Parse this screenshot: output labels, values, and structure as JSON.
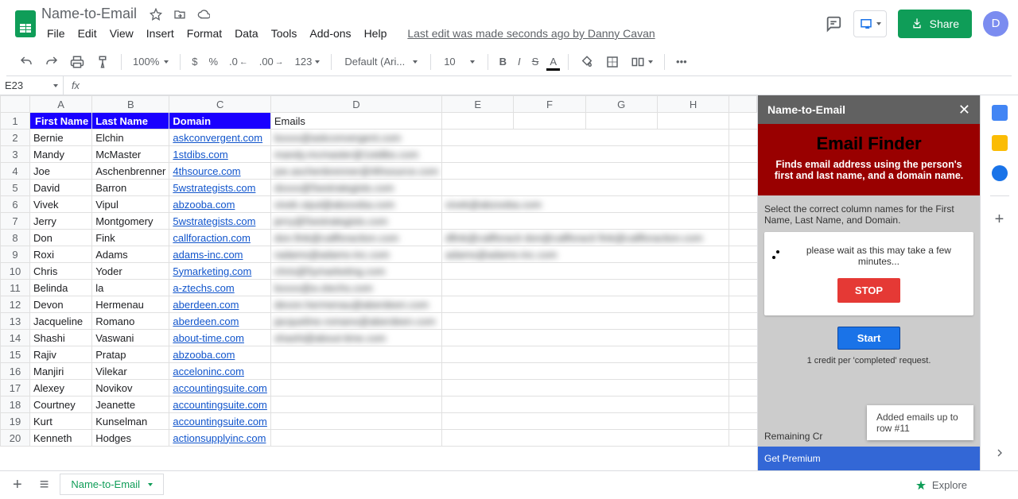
{
  "doc": {
    "title": "Name-to-Email"
  },
  "menubar": [
    "File",
    "Edit",
    "View",
    "Insert",
    "Format",
    "Data",
    "Tools",
    "Add-ons",
    "Help"
  ],
  "last_edit": "Last edit was made seconds ago by Danny Cavan",
  "share_label": "Share",
  "avatar_letter": "D",
  "toolbar": {
    "zoom": "100%",
    "currency": "$",
    "percent": "%",
    "dec_dec": ".0",
    "dec_inc": ".00",
    "num_fmt": "123",
    "font": "Default (Ari...",
    "font_size": "10"
  },
  "name_box": "E23",
  "columns": [
    "A",
    "B",
    "C",
    "D",
    "E",
    "F",
    "G",
    "H"
  ],
  "headers": {
    "A": "First Name",
    "B": "Last Name",
    "C": "Domain",
    "D": "Emails"
  },
  "rows": [
    {
      "n": 2,
      "first": "Bernie",
      "last": "Elchin",
      "domain": "askconvergent.com",
      "email": "bxxxx@askconvergent.com"
    },
    {
      "n": 3,
      "first": "Mandy",
      "last": "McMaster",
      "domain": "1stdibs.com",
      "email": "mandy.mcmaster@1stdibs.com"
    },
    {
      "n": 4,
      "first": "Joe",
      "last": "Aschenbrenner",
      "domain": "4thsource.com",
      "email": "joe.aschenbrenner@4thsource.com"
    },
    {
      "n": 5,
      "first": "David",
      "last": "Barron",
      "domain": "5wstrategists.com",
      "email": "dxxxx@5wstrategists.com"
    },
    {
      "n": 6,
      "first": "Vivek",
      "last": "Vipul",
      "domain": "abzooba.com",
      "email": "vivek.vipul@abzooba.com",
      "e2": "vivek@abzooba.com"
    },
    {
      "n": 7,
      "first": "Jerry",
      "last": "Montgomery",
      "domain": "5wstrategists.com",
      "email": "jerry@5wstrategists.com"
    },
    {
      "n": 8,
      "first": "Don",
      "last": "Fink",
      "domain": "callforaction.com",
      "email": "don.fink@callforaction.com",
      "e2": "dfink@callforacti don@callforacti fink@callforaction.com"
    },
    {
      "n": 9,
      "first": "Roxi",
      "last": "Adams",
      "domain": "adams-inc.com",
      "email": "radams@adams-inc.com",
      "e2": "adams@adams-inc.com"
    },
    {
      "n": 10,
      "first": "Chris",
      "last": "Yoder",
      "domain": "5ymarketing.com",
      "email": "chris@5ymarketing.com"
    },
    {
      "n": 11,
      "first": "Belinda",
      "last": "la",
      "domain": "a-ztechs.com",
      "email": "bxxxx@a-ztechs.com"
    },
    {
      "n": 12,
      "first": "Devon",
      "last": "Hermenau",
      "domain": "aberdeen.com",
      "email": "devon.hermenau@aberdeen.com"
    },
    {
      "n": 13,
      "first": "Jacqueline",
      "last": "Romano",
      "domain": "aberdeen.com",
      "email": "jacqueline.romano@aberdeen.com"
    },
    {
      "n": 14,
      "first": "Shashi",
      "last": "Vaswani",
      "domain": "about-time.com",
      "email": "shashi@about-time.com"
    },
    {
      "n": 15,
      "first": "Rajiv",
      "last": "Pratap",
      "domain": "abzooba.com"
    },
    {
      "n": 16,
      "first": "Manjiri",
      "last": "Vilekar",
      "domain": "acceloninc.com"
    },
    {
      "n": 17,
      "first": "Alexey",
      "last": "Novikov",
      "domain": "accountingsuite.com"
    },
    {
      "n": 18,
      "first": "Courtney",
      "last": "Jeanette",
      "domain": "accountingsuite.com"
    },
    {
      "n": 19,
      "first": "Kurt",
      "last": "Kunselman",
      "domain": "accountingsuite.com"
    },
    {
      "n": 20,
      "first": "Kenneth",
      "last": "Hodges",
      "domain": "actionsupplyinc.com"
    }
  ],
  "sidebar": {
    "header": "Name-to-Email",
    "title": "Email Finder",
    "desc": "Finds email address using the person's first and last name, and a domain name.",
    "instruct": "Select the correct column names for the First Name, Last Name, and Domain.",
    "wait": "please wait as this may take a few minutes...",
    "stop": "STOP",
    "start": "Start",
    "credit": "1 credit per 'completed' request.",
    "remaining": "Remaining Cr",
    "premium": "Get Premium",
    "toast": "Added emails up to row #11"
  },
  "tabs": {
    "sheet": "Name-to-Email",
    "explore": "Explore"
  }
}
